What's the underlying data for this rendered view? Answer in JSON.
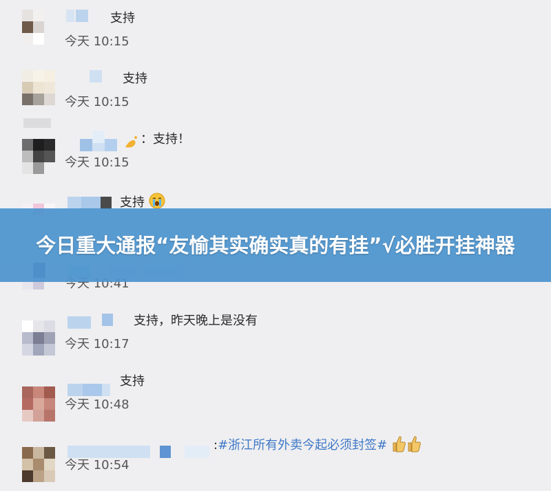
{
  "headline": "今日重大通报“友愉其实确实真的有挂”√必胜开挂神器",
  "comments": [
    {
      "message": "支持",
      "time": "今天 10:15"
    },
    {
      "message": "支持",
      "time": "今天 10:15"
    },
    {
      "message": "：支持！",
      "time": "今天 10:15"
    },
    {
      "message": "支持",
      "time": ""
    },
    {
      "message": "",
      "time": "今天 10:41"
    },
    {
      "message": "支持，昨天晚上是没有",
      "time": "今天 10:17"
    },
    {
      "message": "支持",
      "time": "今天 10:48"
    },
    {
      "message_prefix": ":",
      "topic": "#浙江所有外卖今起必须封签#",
      "time": "今天 10:54"
    }
  ]
}
